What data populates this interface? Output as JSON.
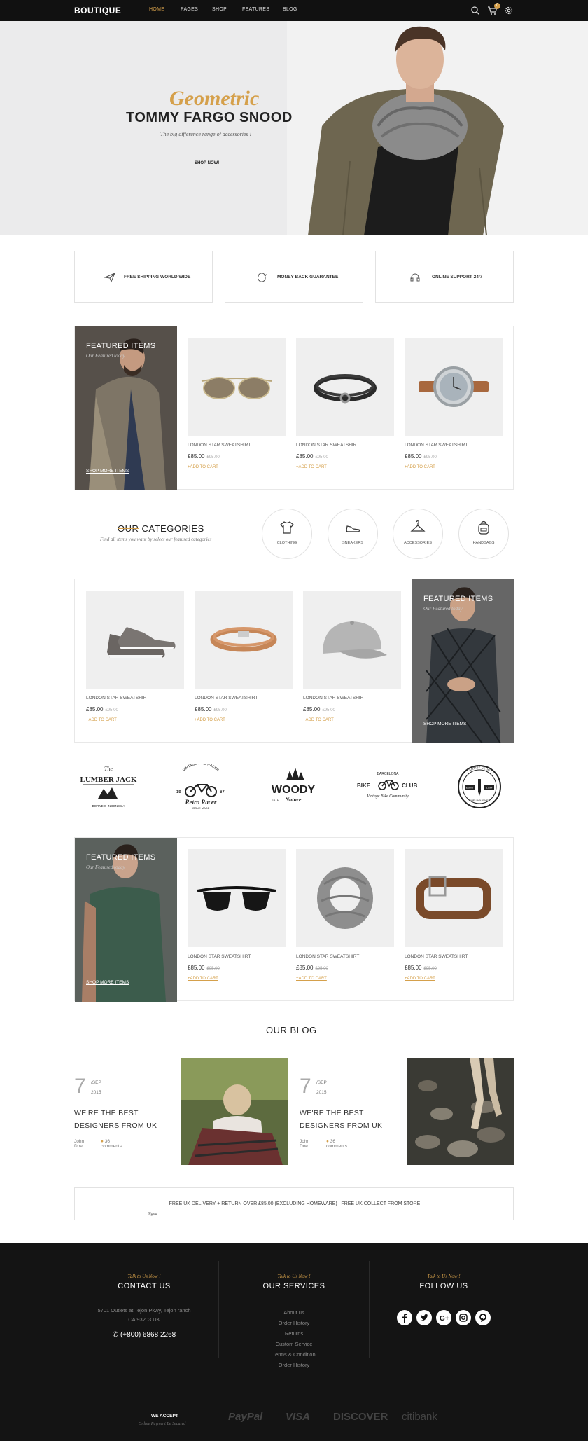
{
  "header": {
    "logo": "BOUTIQUE",
    "nav": [
      "HOME",
      "PAGES",
      "SHOP",
      "FEATURES",
      "BLOG"
    ],
    "cart_count": "0",
    "accent": "#d5a04b"
  },
  "hero": {
    "script": "Geometric",
    "title": "TOMMY FARGO SNOOD",
    "subtitle": "The big difference range of accessories !",
    "button": "SHOP NOW!"
  },
  "features": [
    {
      "label": "FREE SHIPPING WORLD WIDE",
      "icon": "paper-plane-icon"
    },
    {
      "label": "MONEY BACK GUARANTEE",
      "icon": "refresh-icon"
    },
    {
      "label": "ONLINE SUPPORT 24/7",
      "icon": "headset-icon"
    }
  ],
  "sections": [
    {
      "banner": {
        "title": "FEATURED ITEMS",
        "subtitle": "Our Featured today",
        "link": "SHOP MORE ITEMS"
      },
      "products": [
        {
          "name": "LONDON STAR SWEATSHIRT",
          "price": "£85.00",
          "old": "£95.00",
          "cart": "+ADD TO CART",
          "image": "sunglasses"
        },
        {
          "name": "LONDON STAR SWEATSHIRT",
          "price": "£85.00",
          "old": "£95.00",
          "cart": "+ADD TO CART",
          "image": "bracelet"
        },
        {
          "name": "LONDON STAR SWEATSHIRT",
          "price": "£85.00",
          "old": "£95.00",
          "cart": "+ADD TO CART",
          "image": "watch"
        }
      ]
    },
    {
      "banner": {
        "title": "FEATURED ITEMS",
        "subtitle": "Our Featured today",
        "link": "SHOP MORE ITEMS"
      },
      "products": [
        {
          "name": "LONDON STAR SWEATSHIRT",
          "price": "£85.00",
          "old": "£95.00",
          "cart": "+ADD TO CART",
          "image": "sneakers"
        },
        {
          "name": "LONDON STAR SWEATSHIRT",
          "price": "£85.00",
          "old": "£95.00",
          "cart": "+ADD TO CART",
          "image": "leather-bracelet"
        },
        {
          "name": "LONDON STAR SWEATSHIRT",
          "price": "£85.00",
          "old": "£95.00",
          "cart": "+ADD TO CART",
          "image": "cap"
        }
      ]
    },
    {
      "banner": {
        "title": "FEATURED ITEMS",
        "subtitle": "Our Featured today",
        "link": "SHOP MORE ITEMS"
      },
      "products": [
        {
          "name": "LONDON STAR SWEATSHIRT",
          "price": "£85.00",
          "old": "£95.00",
          "cart": "+ADD TO CART",
          "image": "sunglasses-dark"
        },
        {
          "name": "LONDON STAR SWEATSHIRT",
          "price": "£85.00",
          "old": "£95.00",
          "cart": "+ADD TO CART",
          "image": "scarf"
        },
        {
          "name": "LONDON STAR SWEATSHIRT",
          "price": "£85.00",
          "old": "£95.00",
          "cart": "+ADD TO CART",
          "image": "belt"
        }
      ]
    }
  ],
  "categories": {
    "title_prefix": "OUR",
    "title_rest": " CATEGORIES",
    "subtitle": "Find all items you want by select our featured categories",
    "items": [
      "CLOTHING",
      "SNEAKERS",
      "ACCESSORIES",
      "HANDBAGS"
    ]
  },
  "brands": {
    "lumber": {
      "top": "The",
      "main": "LUMBER JACK",
      "bottom": "BORNEO, INDONESIA"
    },
    "retro": {
      "top": "VINTAGE BIKE RACER",
      "main": "Retro Racer",
      "bottom": "ISSUE MADE",
      "left": "19",
      "right": "67"
    },
    "woody": {
      "main": "WOODY",
      "sub": "Nature",
      "est": "ESTD"
    },
    "bike": {
      "top": "BARCELONA",
      "main_left": "BIKE",
      "main_right": "CLUB",
      "sub": "Vintage Bike Community"
    },
    "artist": {
      "top": "ARTIST CLUB",
      "left": "ESTD",
      "right": "1994",
      "bottom": "MELBOURNE"
    }
  },
  "blog": {
    "title_prefix": "OUR",
    "title_rest": " BLOG",
    "posts": [
      {
        "day": "7",
        "month": "/SEP",
        "year": "2015",
        "title": "WE'RE THE BEST DESIGNERS FROM UK",
        "author": "John Doe",
        "comments": "36 comments"
      },
      {
        "day": "7",
        "month": "/SEP",
        "year": "2015",
        "title": "WE'RE THE BEST DESIGNERS FROM UK",
        "author": "John Doe",
        "comments": "36 comments"
      }
    ]
  },
  "delivery": {
    "text": "FREE UK DELIVERY + RETURN OVER £85.00 (EXCLUDING HOMEWARE) | FREE UK COLLECT FROM STORE",
    "signature": "Signa"
  },
  "footer": {
    "contact": {
      "talk": "Talk to Us Now !",
      "title": "CONTACT US",
      "address1": "5701 Outlets at Tejon Pkwy, Tejon ranch",
      "address2": "CA 93203 UK",
      "phone": "(+800) 6868 2268"
    },
    "services": {
      "talk": "Talk to Us Now !",
      "title": "OUR SERVICES",
      "items": [
        "About us",
        "Order History",
        "Returns",
        "Custom Service",
        "Terms & Condition",
        "Order History"
      ]
    },
    "follow": {
      "talk": "Talk to Us Now !",
      "title": "FOLLOW US",
      "icons": [
        "facebook-icon",
        "twitter-icon",
        "google-plus-icon",
        "instagram-icon",
        "pinterest-icon"
      ]
    },
    "accept": "WE ACCEPT",
    "accept_sub": "Online Payment Be Secured",
    "payments": [
      "PayPal",
      "VISA",
      "DISCOVER",
      "citibank"
    ]
  }
}
